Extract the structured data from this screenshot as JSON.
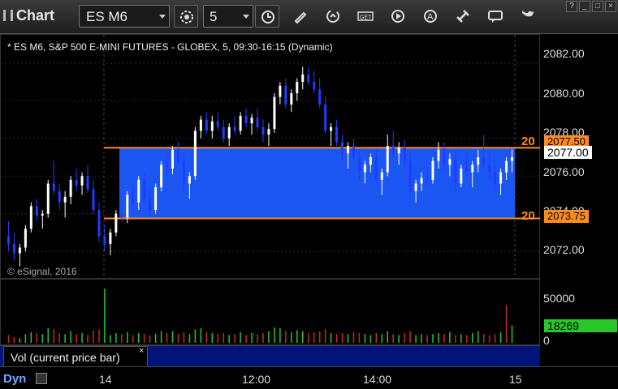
{
  "window": {
    "title": "Chart",
    "symbol": "ES M6",
    "interval": "5",
    "win_controls": [
      "?",
      "_",
      "□",
      "×"
    ]
  },
  "icons": [
    "settings-icon",
    "clock-icon",
    "pencil-icon",
    "refresh-icon",
    "get-icon",
    "play-icon",
    "alert-icon",
    "link-icon",
    "chat-icon",
    "twitter-icon"
  ],
  "chart": {
    "description": "* ES M6, S&P 500 E-MINI FUTURES - GLOBEX, 5, 09:30-16:15 (Dynamic)",
    "copyright": "© eSignal, 2016",
    "left_label_top": "20",
    "left_label_bottom": "20",
    "vol_label": "Vol (current price bar)",
    "vol_close": "×",
    "dyn_label": "Dyn"
  },
  "chart_data": {
    "type": "candlestick",
    "price_axis": {
      "ticks": [
        "2082.00",
        "2080.00",
        "2078.00",
        "2076.00",
        "2074.00",
        "2072.00"
      ],
      "ylim": [
        2070.5,
        2083.5
      ]
    },
    "price_labels": {
      "upper": "2077.50",
      "current": "2077.00",
      "lower": "2073.75"
    },
    "zone": {
      "top": 2077.5,
      "bottom": 2073.75,
      "color": "#1e5bff",
      "border": "#ff8c1a"
    },
    "volume_axis": {
      "ticks": [
        "50000",
        "0"
      ],
      "current": "18269"
    },
    "time_axis": {
      "ticks": [
        "14",
        "12:00",
        "14:00",
        "15"
      ]
    },
    "colors": {
      "up": "#ffffff",
      "down": "#1f3dff",
      "vol_up": "#29c629",
      "vol_down": "#c62929"
    },
    "candles": [
      [
        2072.8,
        2073.6,
        2072.0,
        2072.4
      ],
      [
        2072.4,
        2073.0,
        2071.5,
        2071.9
      ],
      [
        2071.9,
        2072.4,
        2071.2,
        2072.2
      ],
      [
        2072.2,
        2073.4,
        2072.0,
        2073.2
      ],
      [
        2073.2,
        2074.6,
        2073.0,
        2074.4
      ],
      [
        2074.4,
        2074.8,
        2073.6,
        2073.9
      ],
      [
        2073.9,
        2074.2,
        2073.2,
        2074.0
      ],
      [
        2074.0,
        2075.8,
        2073.8,
        2075.6
      ],
      [
        2075.6,
        2076.8,
        2075.0,
        2075.2
      ],
      [
        2075.2,
        2075.6,
        2074.2,
        2074.6
      ],
      [
        2074.6,
        2075.2,
        2073.8,
        2074.9
      ],
      [
        2074.9,
        2076.0,
        2074.5,
        2075.8
      ],
      [
        2075.8,
        2076.4,
        2075.2,
        2075.5
      ],
      [
        2075.5,
        2076.2,
        2075.0,
        2076.0
      ],
      [
        2076.0,
        2076.6,
        2075.1,
        2075.3
      ],
      [
        2075.3,
        2075.8,
        2074.0,
        2074.2
      ],
      [
        2074.2,
        2074.6,
        2072.5,
        2072.8
      ],
      [
        2072.8,
        2073.4,
        2072.0,
        2072.4
      ],
      [
        2072.4,
        2073.2,
        2071.8,
        2073.0
      ],
      [
        2073.0,
        2074.2,
        2072.8,
        2074.0
      ],
      [
        2074.0,
        2074.8,
        2073.6,
        2073.8
      ],
      [
        2073.8,
        2075.2,
        2073.5,
        2075.0
      ],
      [
        2075.0,
        2075.6,
        2074.4,
        2074.6
      ],
      [
        2074.6,
        2076.0,
        2074.2,
        2075.8
      ],
      [
        2075.8,
        2076.2,
        2074.6,
        2074.8
      ],
      [
        2074.8,
        2075.4,
        2073.8,
        2074.2
      ],
      [
        2074.2,
        2075.6,
        2074.0,
        2075.4
      ],
      [
        2075.4,
        2076.8,
        2075.2,
        2076.6
      ],
      [
        2076.6,
        2077.2,
        2076.0,
        2076.4
      ],
      [
        2076.4,
        2077.6,
        2076.1,
        2077.4
      ],
      [
        2077.4,
        2077.8,
        2076.6,
        2076.8
      ],
      [
        2076.8,
        2077.2,
        2075.2,
        2075.6
      ],
      [
        2075.6,
        2076.2,
        2074.8,
        2076.0
      ],
      [
        2076.0,
        2078.6,
        2075.8,
        2078.4
      ],
      [
        2078.4,
        2079.2,
        2078.0,
        2079.0
      ],
      [
        2079.0,
        2079.4,
        2078.2,
        2078.4
      ],
      [
        2078.4,
        2079.2,
        2078.0,
        2078.9
      ],
      [
        2078.9,
        2079.4,
        2078.4,
        2078.6
      ],
      [
        2078.6,
        2079.0,
        2077.8,
        2078.0
      ],
      [
        2078.0,
        2078.8,
        2077.6,
        2078.6
      ],
      [
        2078.6,
        2079.2,
        2078.2,
        2078.4
      ],
      [
        2078.4,
        2079.4,
        2078.2,
        2079.2
      ],
      [
        2079.2,
        2079.6,
        2078.6,
        2078.8
      ],
      [
        2078.8,
        2079.3,
        2078.2,
        2079.1
      ],
      [
        2079.1,
        2079.6,
        2078.4,
        2078.6
      ],
      [
        2078.6,
        2079.0,
        2077.8,
        2078.2
      ],
      [
        2078.2,
        2078.8,
        2077.6,
        2078.5
      ],
      [
        2078.5,
        2080.4,
        2078.3,
        2080.2
      ],
      [
        2080.2,
        2081.0,
        2079.8,
        2080.8
      ],
      [
        2080.8,
        2081.2,
        2079.6,
        2079.8
      ],
      [
        2079.8,
        2080.6,
        2079.4,
        2080.4
      ],
      [
        2080.4,
        2081.2,
        2080.0,
        2081.0
      ],
      [
        2081.0,
        2081.8,
        2080.6,
        2081.4
      ],
      [
        2081.4,
        2081.8,
        2080.8,
        2081.0
      ],
      [
        2081.0,
        2081.6,
        2080.4,
        2080.6
      ],
      [
        2080.6,
        2081.2,
        2079.6,
        2079.8
      ],
      [
        2079.8,
        2080.2,
        2078.2,
        2078.4
      ],
      [
        2078.4,
        2078.8,
        2077.6,
        2078.6
      ],
      [
        2078.6,
        2079.0,
        2077.6,
        2077.8
      ],
      [
        2077.8,
        2078.2,
        2076.8,
        2077.2
      ],
      [
        2077.2,
        2077.8,
        2076.4,
        2077.6
      ],
      [
        2077.6,
        2078.0,
        2076.8,
        2077.0
      ],
      [
        2077.0,
        2077.4,
        2075.8,
        2076.2
      ],
      [
        2076.2,
        2076.8,
        2075.6,
        2076.6
      ],
      [
        2076.6,
        2077.2,
        2076.2,
        2077.0
      ],
      [
        2077.0,
        2077.4,
        2075.6,
        2075.8
      ],
      [
        2075.8,
        2076.4,
        2075.0,
        2076.2
      ],
      [
        2076.2,
        2078.2,
        2076.0,
        2077.6
      ],
      [
        2077.6,
        2078.4,
        2077.0,
        2077.2
      ],
      [
        2077.2,
        2077.8,
        2076.6,
        2077.5
      ],
      [
        2077.5,
        2077.9,
        2076.4,
        2076.8
      ],
      [
        2076.8,
        2077.2,
        2074.8,
        2075.2
      ],
      [
        2075.2,
        2075.8,
        2074.6,
        2075.6
      ],
      [
        2075.6,
        2076.2,
        2075.2,
        2075.9
      ],
      [
        2075.9,
        2076.4,
        2075.4,
        2075.8
      ],
      [
        2075.8,
        2077.0,
        2075.6,
        2076.8
      ],
      [
        2076.8,
        2077.8,
        2076.4,
        2077.4
      ],
      [
        2077.4,
        2077.8,
        2076.2,
        2076.6
      ],
      [
        2076.6,
        2077.2,
        2076.0,
        2076.9
      ],
      [
        2076.9,
        2077.4,
        2075.2,
        2075.6
      ],
      [
        2075.6,
        2076.6,
        2075.4,
        2076.4
      ],
      [
        2076.4,
        2077.2,
        2076.0,
        2076.2
      ],
      [
        2076.2,
        2076.8,
        2075.4,
        2076.6
      ],
      [
        2076.6,
        2077.4,
        2076.2,
        2077.0
      ],
      [
        2077.0,
        2078.2,
        2076.4,
        2076.6
      ],
      [
        2076.6,
        2077.2,
        2075.8,
        2076.2
      ],
      [
        2076.2,
        2076.6,
        2075.2,
        2075.6
      ],
      [
        2075.6,
        2076.4,
        2075.0,
        2076.2
      ],
      [
        2076.2,
        2077.0,
        2075.8,
        2076.8
      ],
      [
        2076.8,
        2077.4,
        2076.2,
        2077.0
      ]
    ],
    "volumes": [
      8,
      6,
      5,
      9,
      11,
      10,
      9,
      15,
      14,
      10,
      9,
      12,
      9,
      10,
      8,
      13,
      14,
      9,
      8,
      10,
      9,
      11,
      8,
      10,
      9,
      8,
      9,
      12,
      10,
      12,
      9,
      11,
      9,
      14,
      15,
      11,
      10,
      9,
      10,
      8,
      9,
      11,
      8,
      10,
      9,
      10,
      12,
      16,
      15,
      12,
      11,
      13,
      12,
      10,
      11,
      12,
      14,
      10,
      9,
      10,
      9,
      11,
      10,
      9,
      8,
      10,
      9,
      12,
      9,
      8,
      10,
      12,
      8,
      9,
      8,
      9,
      10,
      9,
      11,
      8,
      9,
      8,
      10,
      12,
      9,
      8,
      9,
      11,
      40,
      18
    ],
    "vol_scale_max": 62000,
    "vol_tall": [
      {
        "index": 17,
        "value": 56000,
        "up": true
      },
      {
        "index": 88,
        "value": 39000,
        "up": false
      }
    ]
  }
}
